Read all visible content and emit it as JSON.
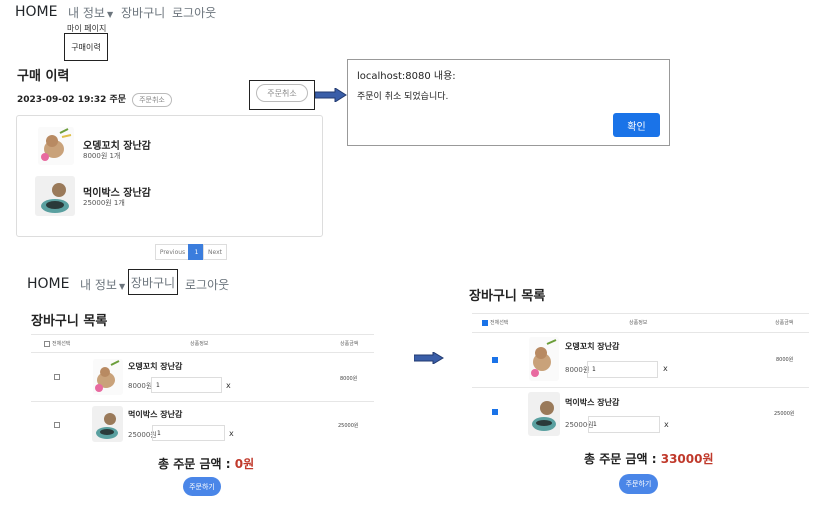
{
  "top_nav": {
    "home": "HOME",
    "my_info": "내 정보",
    "cart": "장바구니",
    "logout": "로그아웃"
  },
  "dropdown": {
    "my_page": "마이 페이지",
    "purchase_history": "구매이력"
  },
  "history": {
    "title": "구매 이력",
    "order_date": "2023-09-02 19:32 주문",
    "cancel_small": "주문취소",
    "cancel_boxed": "주문취소",
    "items": [
      {
        "name": "오뎅꼬치 장난감",
        "sub": "8000원 1개"
      },
      {
        "name": "먹이박스 장난감",
        "sub": "25000원 1개"
      }
    ],
    "pagination": {
      "prev": "Previous",
      "page": "1",
      "next": "Next"
    }
  },
  "alert": {
    "origin": "localhost:8080 내용:",
    "message": "주문이 취소 되었습니다.",
    "confirm": "확인"
  },
  "cart_left": {
    "nav": {
      "home": "HOME",
      "my_info": "내 정보",
      "cart": "장바구니",
      "logout": "로그아웃"
    },
    "title": "장바구니 목록",
    "headers": {
      "select_all": "전체선택",
      "product": "상품정보",
      "amount": "상품금액"
    },
    "rows": [
      {
        "name": "오뎅꼬치 장난감",
        "price": "8000원",
        "qty": "1",
        "remove": "x",
        "amount": "8000원",
        "checked": false
      },
      {
        "name": "먹이박스 장난감",
        "price": "25000원",
        "qty": "1",
        "remove": "x",
        "amount": "25000원",
        "checked": false
      }
    ],
    "total_label": "총 주문 금액 :",
    "total_value": "0원",
    "order_button": "주문하기"
  },
  "cart_right": {
    "title": "장바구니 목록",
    "headers": {
      "select_all": "전체선택",
      "product": "상품정보",
      "amount": "상품금액"
    },
    "rows": [
      {
        "name": "오뎅꼬치 장난감",
        "price": "8000원",
        "qty": "1",
        "remove": "x",
        "amount": "8000원",
        "checked": true
      },
      {
        "name": "먹이박스 장난감",
        "price": "25000원",
        "qty": "1",
        "remove": "x",
        "amount": "25000원",
        "checked": true
      }
    ],
    "total_label": "총 주문 금액 :",
    "total_value": "33000원",
    "order_button": "주문하기"
  },
  "colors": {
    "accent": "#1a73e8",
    "total_red": "#c0392b",
    "arrow": "#3a5ea8"
  },
  "icons": [
    "caret-down-icon",
    "arrow-right-icon",
    "checkbox-icon",
    "product-thumbnail-image"
  ]
}
